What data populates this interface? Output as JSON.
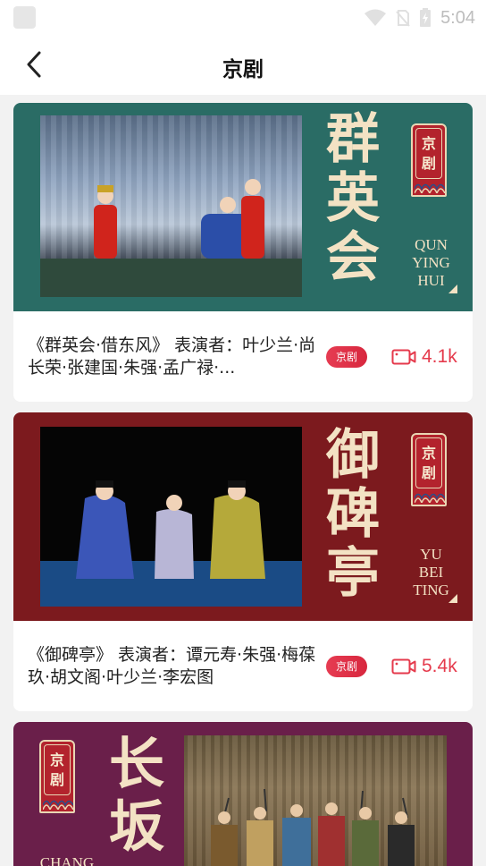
{
  "status_bar": {
    "time": "5:04"
  },
  "header": {
    "title": "京剧"
  },
  "cards": [
    {
      "banner_title_chars": [
        "群",
        "英",
        "会"
      ],
      "seal_chars": [
        "京",
        "剧"
      ],
      "banner_roman": [
        "QUN",
        "YING",
        "HUI"
      ],
      "description": "《群英会·借东风》 表演者：叶少兰·尚长荣·张建国·朱强·孟广禄·...",
      "tag": "京剧",
      "views": "4.1k",
      "banner_color": "#2a6c65"
    },
    {
      "banner_title_chars": [
        "御",
        "碑",
        "亭"
      ],
      "seal_chars": [
        "京",
        "剧"
      ],
      "banner_roman": [
        "YU",
        "BEI",
        "TING"
      ],
      "description": "《御碑亭》 表演者：谭元寿·朱强·梅葆玖·胡文阁·叶少兰·李宏图",
      "tag": "京剧",
      "views": "5.4k",
      "banner_color": "#7c1a1e"
    },
    {
      "banner_title_chars": [
        "长",
        "坂"
      ],
      "seal_chars": [
        "京",
        "剧"
      ],
      "banner_roman": [
        "CHANG"
      ],
      "banner_color": "#6a1f4a"
    }
  ]
}
